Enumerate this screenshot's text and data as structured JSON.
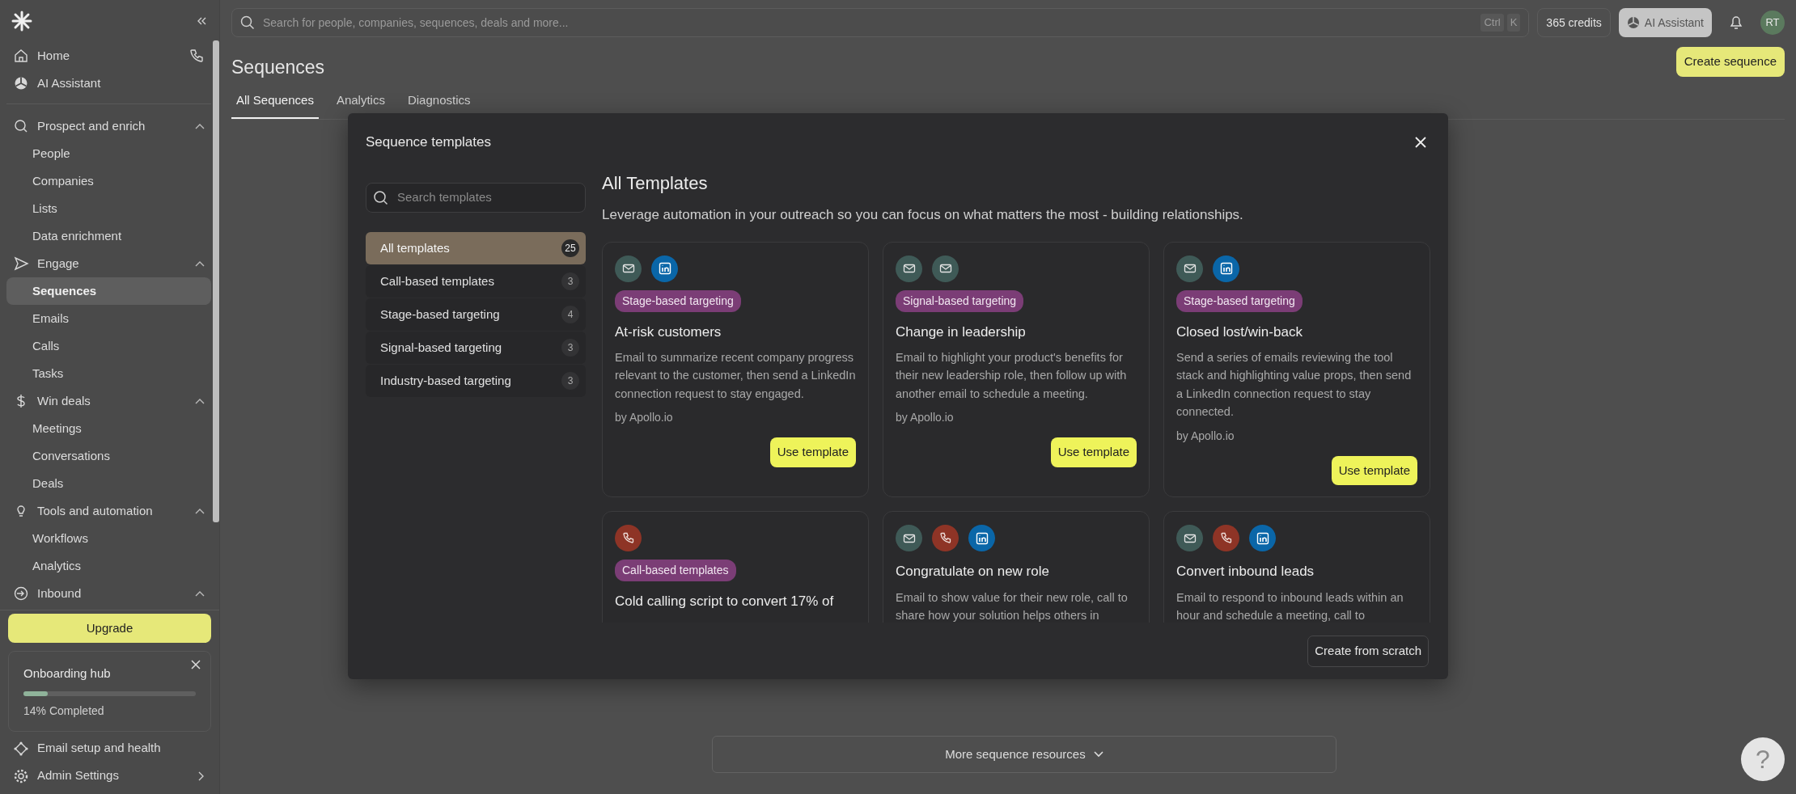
{
  "sidebar": {
    "top_items": [
      {
        "label": "Home"
      },
      {
        "label": "AI Assistant"
      }
    ],
    "sections": [
      {
        "label": "Prospect and enrich",
        "expanded": true,
        "items": [
          {
            "label": "People",
            "selected": false
          },
          {
            "label": "Companies",
            "selected": false
          },
          {
            "label": "Lists",
            "selected": false
          },
          {
            "label": "Data enrichment",
            "selected": false
          }
        ]
      },
      {
        "label": "Engage",
        "expanded": true,
        "items": [
          {
            "label": "Sequences",
            "selected": true
          },
          {
            "label": "Emails",
            "selected": false
          },
          {
            "label": "Calls",
            "selected": false
          },
          {
            "label": "Tasks",
            "selected": false
          }
        ]
      },
      {
        "label": "Win deals",
        "expanded": true,
        "items": [
          {
            "label": "Meetings",
            "selected": false
          },
          {
            "label": "Conversations",
            "selected": false
          },
          {
            "label": "Deals",
            "selected": false
          }
        ]
      },
      {
        "label": "Tools and automation",
        "expanded": true,
        "items": [
          {
            "label": "Workflows",
            "selected": false
          },
          {
            "label": "Analytics",
            "selected": false
          }
        ]
      },
      {
        "label": "Inbound",
        "expanded": true
      }
    ],
    "upgrade_button": "Upgrade",
    "onboarding": {
      "title": "Onboarding hub",
      "level": 0.14,
      "status": "14% Completed"
    },
    "bottom_items": [
      {
        "label": "Email setup and health"
      },
      {
        "label": "Admin Settings"
      }
    ]
  },
  "top_bar": {
    "search_placeholder": "Search for people, companies, sequences, deals and more...",
    "shortcut_keys": [
      "Ctrl",
      "K"
    ],
    "credits": "365 credits",
    "ai_button": "AI Assistant",
    "avatar": "RT"
  },
  "header": {
    "title": "Sequences",
    "create_button": "Create sequence",
    "tabs": [
      {
        "label": "All Sequences",
        "selected": true
      },
      {
        "label": "Analytics",
        "selected": false
      },
      {
        "label": "Diagnostics",
        "selected": false
      }
    ]
  },
  "modal": {
    "title": "Sequence templates",
    "search_placeholder": "Search templates",
    "categories": [
      {
        "label": "All templates",
        "count": "25",
        "selected": true
      },
      {
        "label": "Call-based templates",
        "count": "3",
        "selected": false
      },
      {
        "label": "Stage-based targeting",
        "count": "4",
        "selected": false
      },
      {
        "label": "Signal-based targeting",
        "count": "3",
        "selected": false
      },
      {
        "label": "Industry-based targeting",
        "count": "3",
        "selected": false
      }
    ],
    "heading": "All Templates",
    "subtitle": "Leverage automation in your outreach so you can focus on what matters the most - building relationships.",
    "templates": [
      {
        "channels": [
          {
            "kind": "email"
          },
          {
            "kind": "linkedin"
          }
        ],
        "tag": "Stage-based targeting",
        "title": "At-risk customers",
        "description": "Email to summarize recent company progress relevant to the customer, then send a LinkedIn connection request to stay engaged.",
        "author": "by Apollo.io",
        "button": "Use template"
      },
      {
        "channels": [
          {
            "kind": "email"
          },
          {
            "kind": "email"
          }
        ],
        "tag": "Signal-based targeting",
        "title": "Change in leadership",
        "description": "Email to highlight your product's benefits for their new leadership role, then follow up with another email to schedule a meeting.",
        "author": "by Apollo.io",
        "button": "Use template"
      },
      {
        "channels": [
          {
            "kind": "email"
          },
          {
            "kind": "linkedin"
          }
        ],
        "tag": "Stage-based targeting",
        "title": "Closed lost/win-back",
        "description": "Send a series of emails reviewing the tool stack and highlighting value props, then send a LinkedIn connection request to stay connected.",
        "author": "by Apollo.io",
        "button": "Use template"
      },
      {
        "channels": [
          {
            "kind": "phone"
          }
        ],
        "tag": "Call-based templates",
        "title": "Cold calling script to convert 17% of"
      },
      {
        "channels": [
          {
            "kind": "email"
          },
          {
            "kind": "phone"
          },
          {
            "kind": "linkedin"
          }
        ],
        "title": "Congratulate on new role",
        "description": "Email to show value for their new role, call to share how your solution helps others in"
      },
      {
        "channels": [
          {
            "kind": "email"
          },
          {
            "kind": "phone"
          },
          {
            "kind": "linkedin"
          }
        ],
        "title": "Convert inbound leads",
        "description": "Email to respond to inbound leads within an hour and schedule a meeting, call to"
      }
    ],
    "footer_button": "Create from scratch"
  },
  "resources_button": "More sequence resources",
  "help_button": "?"
}
